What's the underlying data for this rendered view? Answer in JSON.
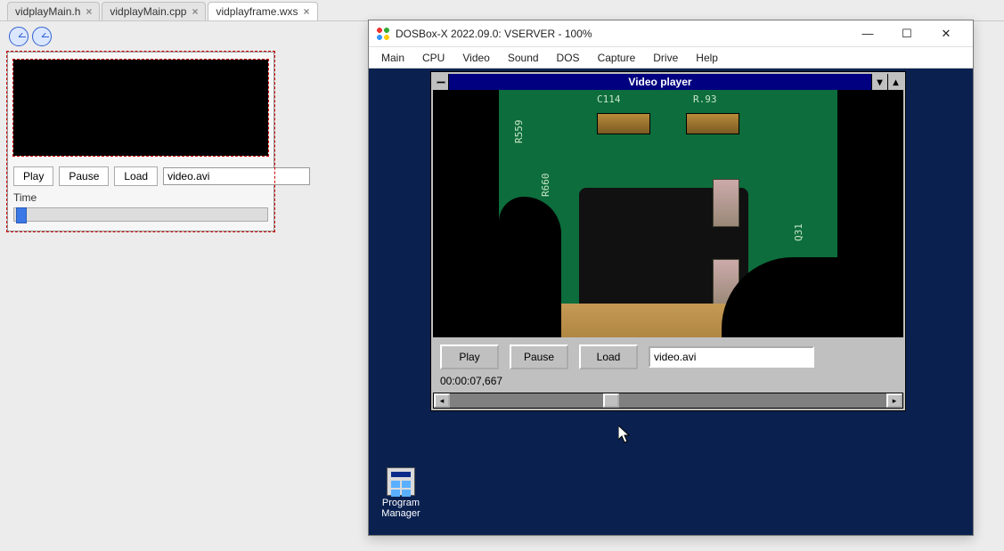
{
  "ide": {
    "tabs": [
      {
        "label": "vidplayMain.h",
        "active": false
      },
      {
        "label": "vidplayMain.cpp",
        "active": false
      },
      {
        "label": "vidplayframe.wxs",
        "active": true
      }
    ]
  },
  "designer": {
    "buttons": {
      "play": "Play",
      "pause": "Pause",
      "load": "Load"
    },
    "filename_value": "video.avi",
    "time_label": "Time"
  },
  "dosbox": {
    "title": "DOSBox-X 2022.09.0: VSERVER - 100%",
    "menus": [
      "Main",
      "CPU",
      "Video",
      "Sound",
      "DOS",
      "Capture",
      "Drive",
      "Help"
    ]
  },
  "win31": {
    "title": "Video player",
    "buttons": {
      "play": "Play",
      "pause": "Pause",
      "load": "Load"
    },
    "filename_value": "video.avi",
    "time_text": "00:00:07,667",
    "scroll_thumb_left_percent": 35
  },
  "pcb_labels": {
    "c114": "C114",
    "r93": "R.93",
    "r559": "R559",
    "r660": "R660",
    "q31": "Q31"
  },
  "progman_label_1": "Program",
  "progman_label_2": "Manager"
}
